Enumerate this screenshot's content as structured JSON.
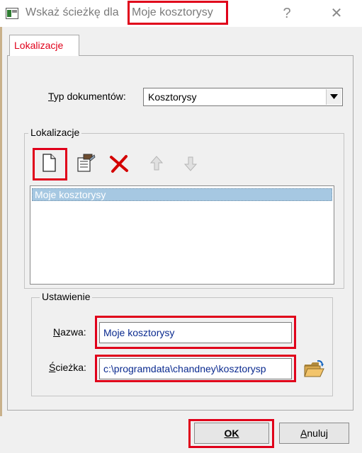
{
  "window": {
    "title_prefix": "Wskaż ścieżkę dla",
    "title_path": "Moje kosztorysy",
    "help_glyph": "?",
    "close_glyph": "✕"
  },
  "tabs": [
    {
      "label": "Lokalizacje",
      "active": true
    }
  ],
  "document_type": {
    "label_first": "T",
    "label_rest": "yp dokumentów:",
    "value": "Kosztorysy"
  },
  "locations_group": {
    "title": "Lokalizacje",
    "toolbar": [
      "new-document-icon",
      "edit-properties-icon",
      "delete-icon",
      "arrow-up-icon",
      "arrow-down-icon"
    ],
    "items": [
      {
        "label": "Moje kosztorysy",
        "selected": true
      }
    ]
  },
  "settings_group": {
    "title": "Ustawienie",
    "name_label_first": "N",
    "name_label_rest": "azwa:",
    "name_value": "Moje kosztorysy",
    "path_label_first": "Ś",
    "path_label_rest": "cieżka:",
    "path_value": "c:\\programdata\\chandney\\kosztorysp"
  },
  "buttons": {
    "ok": "OK",
    "cancel_first": "A",
    "cancel_rest": "nuluj"
  },
  "colors": {
    "highlight": "#e0001a",
    "tab_label": "#e0001a",
    "field_text": "#0a2a8f",
    "selection": "#a6c8e2"
  }
}
